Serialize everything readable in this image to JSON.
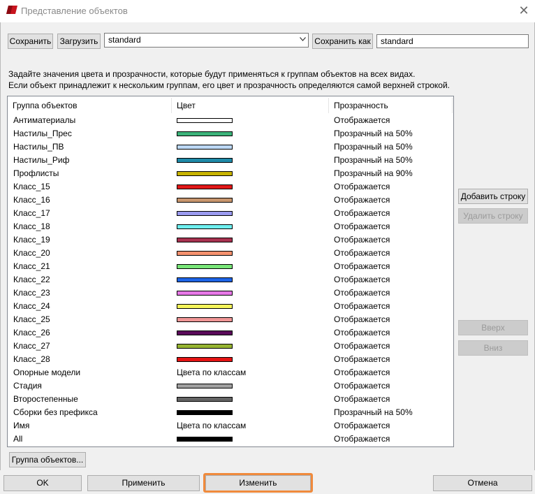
{
  "window": {
    "title": "Представление объектов",
    "close_glyph": "✕",
    "icon": "app-logo-icon"
  },
  "toolbar": {
    "save_label": "Сохранить",
    "load_label": "Загрузить",
    "preset_value": "standard",
    "save_as_label": "Сохранить как",
    "save_as_value": "standard"
  },
  "description": {
    "line1": "Задайте значения цвета и прозрачности, которые будут применяться к группам объектов на всех видах.",
    "line2": "Если объект принадлежит к нескольким группам, его цвет и прозрачность определяются самой верхней строкой."
  },
  "table": {
    "headers": {
      "group": "Группа объектов",
      "color": "Цвет",
      "transparency": "Прозрачность"
    },
    "rows": [
      {
        "name": "Антиматериалы",
        "color": "#ffffff",
        "transparency": "Отображается"
      },
      {
        "name": "Настилы_Прес",
        "color": "#3cb37a",
        "transparency": "Прозрачный на 50%"
      },
      {
        "name": "Настилы_ПВ",
        "color": "#bcd8f5",
        "transparency": "Прозрачный на 50%"
      },
      {
        "name": "Настилы_Риф",
        "color": "#1f8aa8",
        "transparency": "Прозрачный на 50%"
      },
      {
        "name": "Профлисты",
        "color": "#c8b400",
        "transparency": "Прозрачный на 90%"
      },
      {
        "name": "Класс_15",
        "color": "#e01818",
        "transparency": "Отображается"
      },
      {
        "name": "Класс_16",
        "color": "#c8966e",
        "transparency": "Отображается"
      },
      {
        "name": "Класс_17",
        "color": "#9b9bf0",
        "transparency": "Отображается"
      },
      {
        "name": "Класс_18",
        "color": "#6ef0f0",
        "transparency": "Отображается"
      },
      {
        "name": "Класс_19",
        "color": "#a83250",
        "transparency": "Отображается"
      },
      {
        "name": "Класс_20",
        "color": "#f5916e",
        "transparency": "Отображается"
      },
      {
        "name": "Класс_21",
        "color": "#78e678",
        "transparency": "Отображается"
      },
      {
        "name": "Класс_22",
        "color": "#1e64e6",
        "transparency": "Отображается"
      },
      {
        "name": "Класс_23",
        "color": "#e678e6",
        "transparency": "Отображается"
      },
      {
        "name": "Класс_24",
        "color": "#f5f55a",
        "transparency": "Отображается"
      },
      {
        "name": "Класс_25",
        "color": "#f09696",
        "transparency": "Отображается"
      },
      {
        "name": "Класс_26",
        "color": "#5a0a5a",
        "transparency": "Отображается"
      },
      {
        "name": "Класс_27",
        "color": "#96b432",
        "transparency": "Отображается"
      },
      {
        "name": "Класс_28",
        "color": "#e61414",
        "transparency": "Отображается"
      },
      {
        "name": "Опорные модели",
        "color_text": "Цвета по классам",
        "transparency": "Отображается"
      },
      {
        "name": "Стадия",
        "color": "#a0a0a0",
        "transparency": "Отображается"
      },
      {
        "name": "Второстепенные",
        "color": "#646464",
        "transparency": "Отображается"
      },
      {
        "name": "Сборки без префикса",
        "color": "#000000",
        "transparency": "Прозрачный на 50%"
      },
      {
        "name": "Имя",
        "color_text": "Цвета по классам",
        "transparency": "Отображается"
      },
      {
        "name": "All",
        "color": "#000000",
        "transparency": "Отображается"
      }
    ]
  },
  "side_buttons": {
    "add_row": "Добавить строку",
    "delete_row": "Удалить строку",
    "up": "Вверх",
    "down": "Вниз"
  },
  "group_button_label": "Группа объектов...",
  "footer": {
    "ok": "OK",
    "apply": "Применить",
    "modify": "Изменить",
    "cancel": "Отмена"
  },
  "accent_color": "#f08a3c"
}
